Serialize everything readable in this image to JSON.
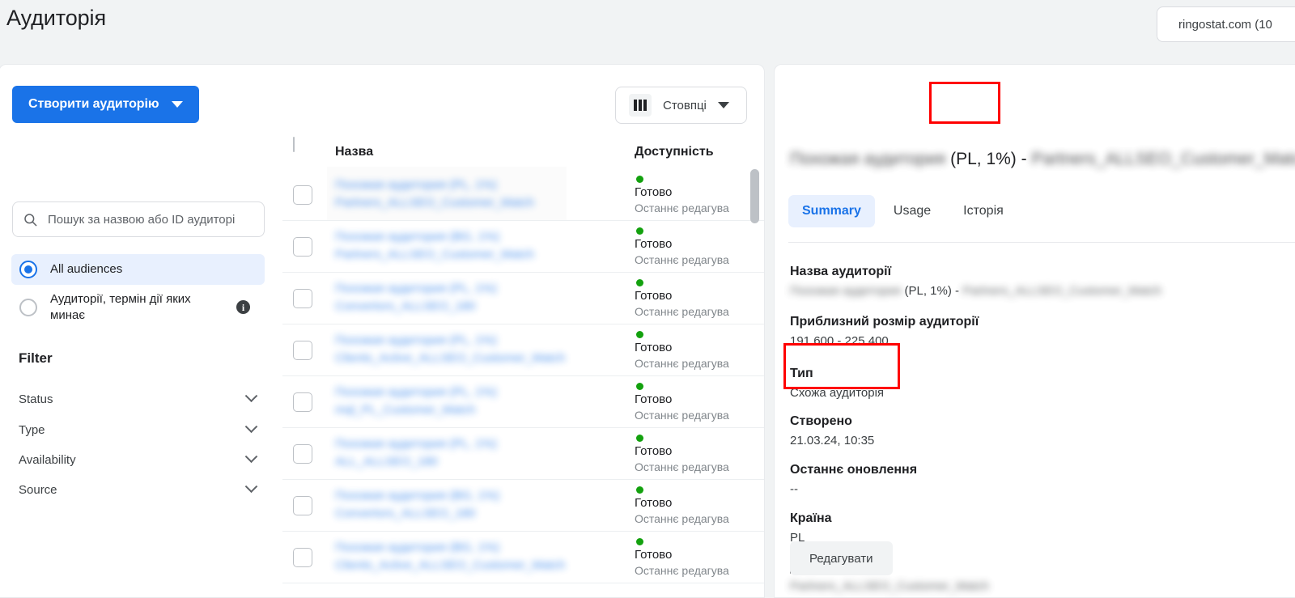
{
  "header": {
    "title": "Аудиторія",
    "account": "ringostat.com (10"
  },
  "sidebar": {
    "create_button": "Створити аудиторію",
    "search_placeholder": "Пошук за назвою або ID аудиторі",
    "search_value": "",
    "radios": [
      {
        "label": "All audiences",
        "selected": true
      },
      {
        "label": "Аудиторії, термін дії яких минає",
        "selected": false
      }
    ],
    "filter_title": "Filter",
    "filters": [
      {
        "label": "Status"
      },
      {
        "label": "Type"
      },
      {
        "label": "Availability"
      },
      {
        "label": "Source"
      }
    ]
  },
  "table": {
    "columns_button": "Стовпці",
    "headers": {
      "name": "Назва",
      "availability": "Доступність"
    },
    "status_label": "Готово",
    "last_edit_label": "Останнє редагува",
    "rows": [
      {
        "name_line1": "Похожая аудитория (PL, 1%)",
        "name_line2": "Partners_ALLSEO_Customer_Match",
        "status": "Готово",
        "sub": "Останнє редагува"
      },
      {
        "name_line1": "Похожая аудитория (BG, 1%)",
        "name_line2": "Partners_ALLSEO_Customer_Match",
        "status": "Готово",
        "sub": "Останнє редагува"
      },
      {
        "name_line1": "Похожая аудитория (PL, 1%)",
        "name_line2": "Convertors_ALLSEO_180",
        "status": "Готово",
        "sub": "Останнє редагува"
      },
      {
        "name_line1": "Похожая аудитория (PL, 1%)",
        "name_line2": "Clients_Active_ALLSEO_Customer_Match",
        "status": "Готово",
        "sub": "Останнє редагува"
      },
      {
        "name_line1": "Похожая аудитория (PL, 1%)",
        "name_line2": "mql_PL_Customer_Match",
        "status": "Готово",
        "sub": "Останнє редагува"
      },
      {
        "name_line1": "Похожая аудитория (PL, 1%)",
        "name_line2": "ALL_ALLSEO_180",
        "status": "Готово",
        "sub": "Останнє редагува"
      },
      {
        "name_line1": "Похожая аудитория (BG, 1%)",
        "name_line2": "Convertors_ALLSEO_180",
        "status": "Готово",
        "sub": "Останнє редагува"
      },
      {
        "name_line1": "Похожая аудитория (BG, 1%)",
        "name_line2": "Clients_Active_ALLSEO_Customer_Match",
        "status": "Готово",
        "sub": "Останнє редагува"
      }
    ]
  },
  "details": {
    "title_blurred_left": "Похожая аудитория",
    "title_highlight": "(PL, 1%)",
    "title_dash": " - ",
    "title_blurred_right": "Partners_ALLSEO_Customer_Match",
    "tabs": [
      {
        "label": "Summary",
        "active": true
      },
      {
        "label": "Usage",
        "active": false
      },
      {
        "label": "Історія",
        "active": false
      }
    ],
    "fields": [
      {
        "label": "Назва аудиторії",
        "value_blur_left": "Похожая аудитория",
        "value_mid": "(PL, 1%) - ",
        "value_blur_right": "Partners_ALLSEO_Customer_Match"
      },
      {
        "label": "Приблизний розмір аудиторії",
        "value": "191 600 - 225 400"
      },
      {
        "label": "Тип",
        "value": "Схожа аудиторія"
      },
      {
        "label": "Створено",
        "value": "21.03.24, 10:35"
      },
      {
        "label": "Останнє оновлення",
        "value": "--"
      },
      {
        "label": "Країна",
        "value": "PL"
      },
      {
        "label": "Джерело",
        "value_blurred": "Partners_ALLSEO_Customer_Match"
      }
    ],
    "edit_button": "Редагувати"
  },
  "colors": {
    "accent": "#1a73e8",
    "accent_bg": "#e8f0fe",
    "status_green": "#13a10e",
    "annotation_red": "#ff0000",
    "page_bg": "#f1f3f4"
  }
}
